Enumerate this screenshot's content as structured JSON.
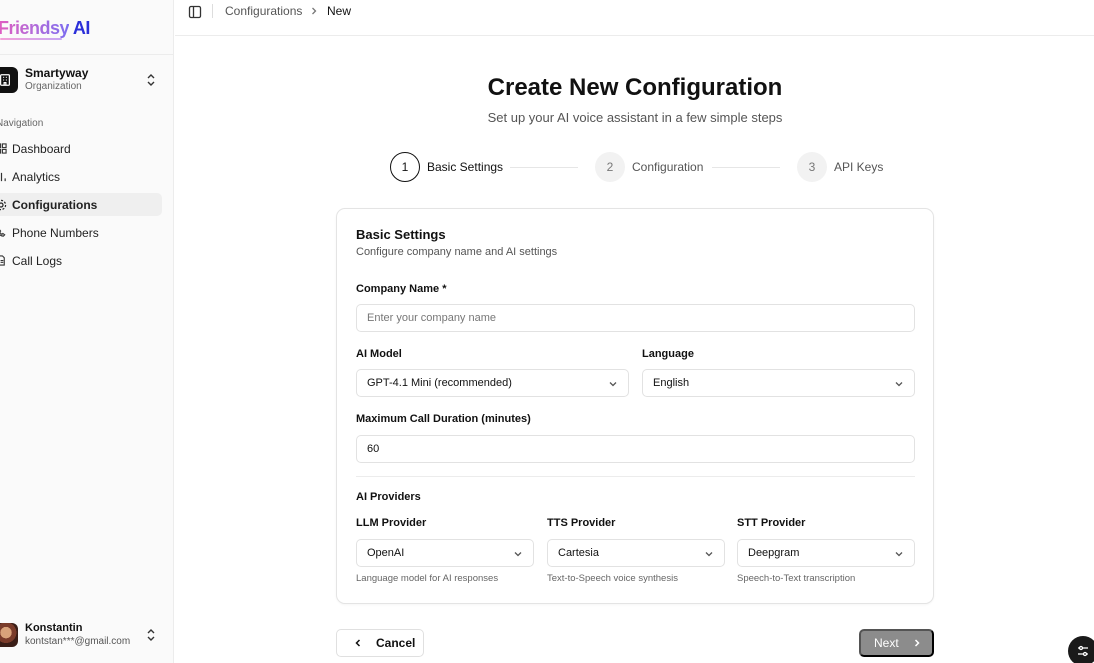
{
  "app": {
    "logo_brand": "Friendsy",
    "logo_ai": "AI"
  },
  "org": {
    "name": "Smartyway",
    "subtitle": "Organization"
  },
  "nav": {
    "label": "Navigation",
    "items": [
      {
        "label": "Dashboard",
        "icon": "grid-icon"
      },
      {
        "label": "Analytics",
        "icon": "bar-chart-icon"
      },
      {
        "label": "Configurations",
        "icon": "gear-icon",
        "active": true
      },
      {
        "label": "Phone Numbers",
        "icon": "phone-icon"
      },
      {
        "label": "Call Logs",
        "icon": "document-icon"
      }
    ]
  },
  "user": {
    "name": "Konstantin",
    "email": "kontstan***@gmail.com"
  },
  "breadcrumb": {
    "parent": "Configurations",
    "current": "New"
  },
  "page": {
    "title": "Create New Configuration",
    "subtitle": "Set up your AI voice assistant in a few simple steps"
  },
  "steps": [
    {
      "number": "1",
      "label": "Basic Settings",
      "active": true
    },
    {
      "number": "2",
      "label": "Configuration"
    },
    {
      "number": "3",
      "label": "API Keys"
    }
  ],
  "card": {
    "title": "Basic Settings",
    "description": "Configure company name and AI settings",
    "company_name": {
      "label": "Company Name *",
      "placeholder": "Enter your company name",
      "value": ""
    },
    "ai_model": {
      "label": "AI Model",
      "value": "GPT-4.1 Mini (recommended)"
    },
    "language": {
      "label": "Language",
      "value": "English"
    },
    "max_duration": {
      "label": "Maximum Call Duration (minutes)",
      "value": "60"
    },
    "providers": {
      "label": "AI Providers",
      "llm": {
        "label": "LLM Provider",
        "value": "OpenAI",
        "help": "Language model for AI responses"
      },
      "tts": {
        "label": "TTS Provider",
        "value": "Cartesia",
        "help": "Text-to-Speech voice synthesis"
      },
      "stt": {
        "label": "STT Provider",
        "value": "Deepgram",
        "help": "Speech-to-Text transcription"
      }
    }
  },
  "buttons": {
    "cancel": "Cancel",
    "next": "Next"
  },
  "colors": {
    "accent": "#111111",
    "next_disabled": "#8c8c8c",
    "logo_blue": "#2b2fd9",
    "logo_pink": "#e05cc0"
  }
}
